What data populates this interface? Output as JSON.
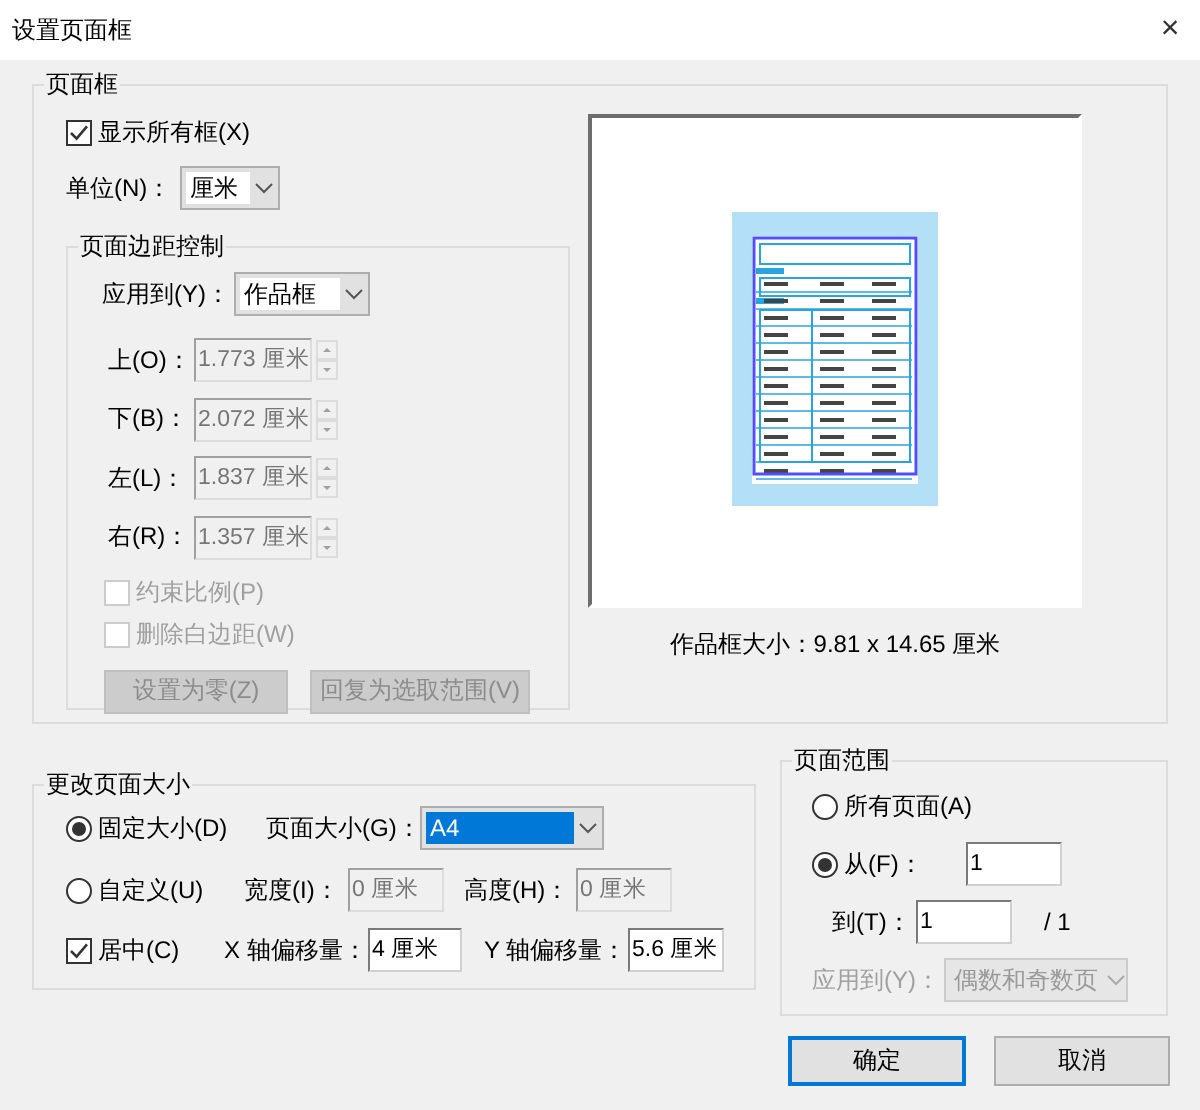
{
  "window": {
    "title": "设置页面框",
    "close": "×"
  },
  "page_frame": {
    "title": "页面框",
    "show_all": {
      "label": "显示所有框(X)",
      "checked": true
    },
    "unit": {
      "label": "单位(N)：",
      "value": "厘米"
    },
    "margins": {
      "title": "页面边距控制",
      "apply_to": {
        "label": "应用到(Y)：",
        "value": "作品框"
      },
      "fields": [
        {
          "label": "上(O)：",
          "value": "1.773 厘米",
          "disabled": true
        },
        {
          "label": "下(B)：",
          "value": "2.072 厘米",
          "disabled": true
        },
        {
          "label": "左(L)：",
          "value": "1.837 厘米",
          "disabled": true
        },
        {
          "label": "右(R)：",
          "value": "1.357 厘米",
          "disabled": true
        }
      ],
      "options": [
        {
          "label": "约束比例(P)",
          "checked": false,
          "disabled": true
        },
        {
          "label": "删除白边距(W)",
          "checked": false,
          "disabled": true
        }
      ],
      "buttons": [
        {
          "label": "设置为零(Z)",
          "disabled": true
        },
        {
          "label": "回复为选取范围(V)",
          "disabled": true
        }
      ]
    },
    "size_caption": "作品框大小：9.81 x 14.65 厘米"
  },
  "change_size": {
    "title": "更改页面大小",
    "modes": [
      {
        "label": "固定大小(D)",
        "selected": true
      },
      {
        "label": "自定义(U)",
        "selected": false
      }
    ],
    "page_size": {
      "label": "页面大小(G)：",
      "value": "A4"
    },
    "width": {
      "label": "宽度(I)：",
      "value": "0 厘米",
      "disabled": true
    },
    "height": {
      "label": "高度(H)：",
      "value": "0 厘米",
      "disabled": true
    },
    "center": {
      "label": "居中(C)",
      "checked": true
    },
    "x_offset": {
      "label": "X 轴偏移量：",
      "value": "4 厘米",
      "disabled": false
    },
    "y_offset": {
      "label": "Y 轴偏移量：",
      "value": "5.6 厘米",
      "disabled": false
    }
  },
  "page_range": {
    "title": "页面范围",
    "modes": [
      {
        "label": "所有页面(A)",
        "selected": false
      },
      {
        "label": "从(F)：",
        "selected": true
      }
    ],
    "from_value": "1",
    "to": {
      "label": "到(T)：",
      "value": "1"
    },
    "total": "/ 1",
    "apply_to": {
      "label": "应用到(Y)：",
      "value": "偶数和奇数页",
      "disabled": true
    }
  },
  "buttons": [
    {
      "label": "确定",
      "default": true
    },
    {
      "label": "取消",
      "default": false
    }
  ]
}
